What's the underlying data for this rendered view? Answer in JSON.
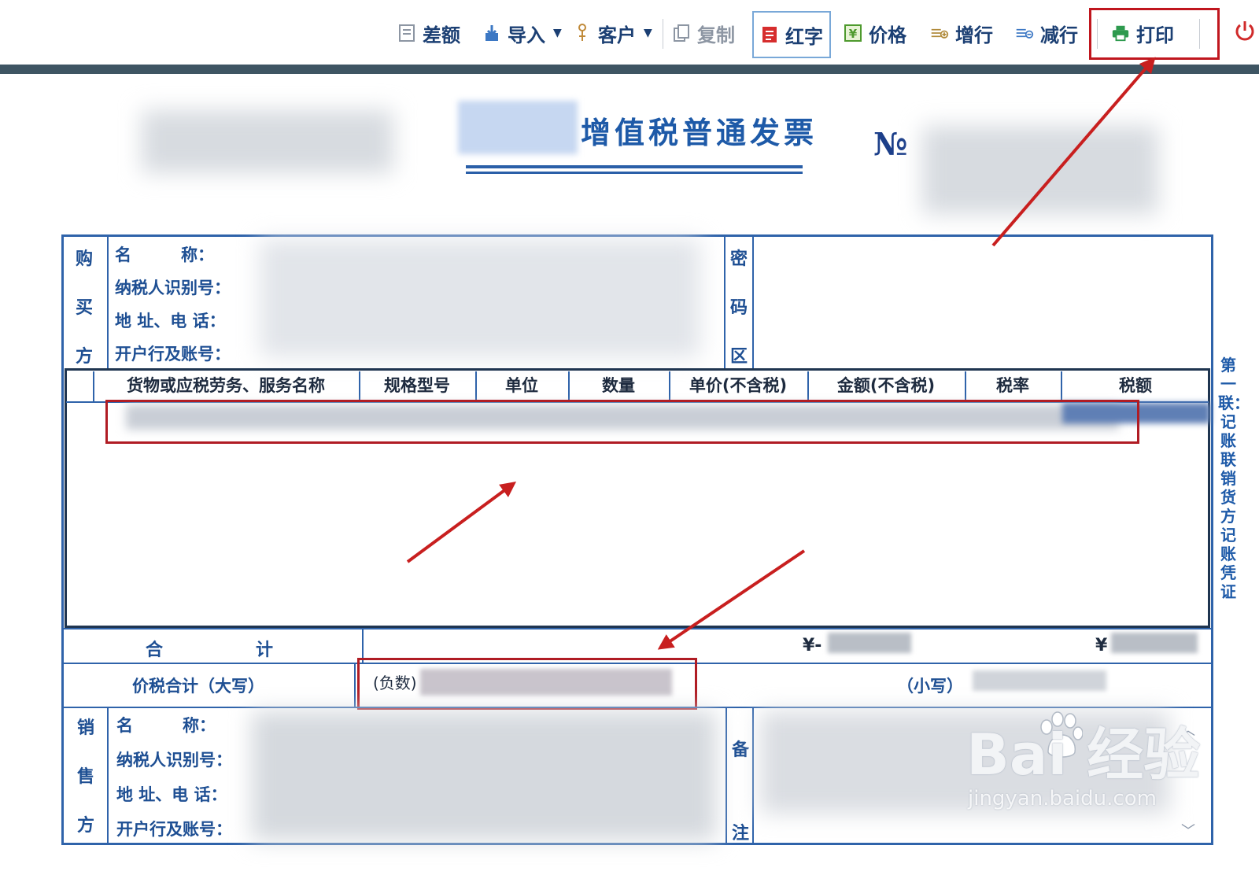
{
  "toolbar": {
    "items": [
      {
        "label": "差额",
        "icon": "document-icon"
      },
      {
        "label": "导入",
        "icon": "import-icon",
        "has_dropdown": true
      },
      {
        "label": "客户",
        "icon": "client-icon",
        "has_dropdown": true
      },
      {
        "label": "复制",
        "icon": "copy-icon"
      },
      {
        "label": "红字",
        "icon": "red-invoice-icon"
      },
      {
        "label": "价格",
        "icon": "price-icon"
      },
      {
        "label": "增行",
        "icon": "add-row-icon"
      },
      {
        "label": "减行",
        "icon": "remove-row-icon"
      },
      {
        "label": "打印",
        "icon": "printer-icon"
      }
    ],
    "power_icon": "power-icon"
  },
  "invoice": {
    "title": "增值税普通发票",
    "no_mark": "№",
    "buyer": {
      "side_label": [
        "购",
        "买",
        "方"
      ],
      "fields": [
        "名　　　称：",
        "纳税人识别号：",
        "地 址、电 话：",
        "开户行及账号："
      ]
    },
    "cipher_label": [
      "密",
      "码",
      "区"
    ],
    "columns": [
      "货物或应税劳务、服务名称",
      "规格型号",
      "单位",
      "数量",
      "单价(不含税)",
      "金额(不含税)",
      "税率",
      "税额"
    ],
    "totals": {
      "label": "合计",
      "amount_prefix": "¥-",
      "tax_prefix": "¥"
    },
    "grand_total": {
      "label": "价税合计（大写）",
      "negative_prefix": "(负数)",
      "small_label": "（小写）"
    },
    "seller": {
      "side_label": [
        "销",
        "售",
        "方"
      ],
      "fields": [
        "名　　　称：",
        "纳税人识别号：",
        "地 址、电 话：",
        "开户行及账号："
      ]
    },
    "remark_label": [
      "备",
      "注"
    ],
    "copy_note": "第一联：记账联 销货方记账凭证"
  },
  "watermark": {
    "text": "Bai 经验",
    "url": "jingyan.baidu.com"
  },
  "colors": {
    "invoice_blue": "#2f63aa",
    "highlight_red": "#c0161e",
    "header_bar": "#3e5563"
  }
}
